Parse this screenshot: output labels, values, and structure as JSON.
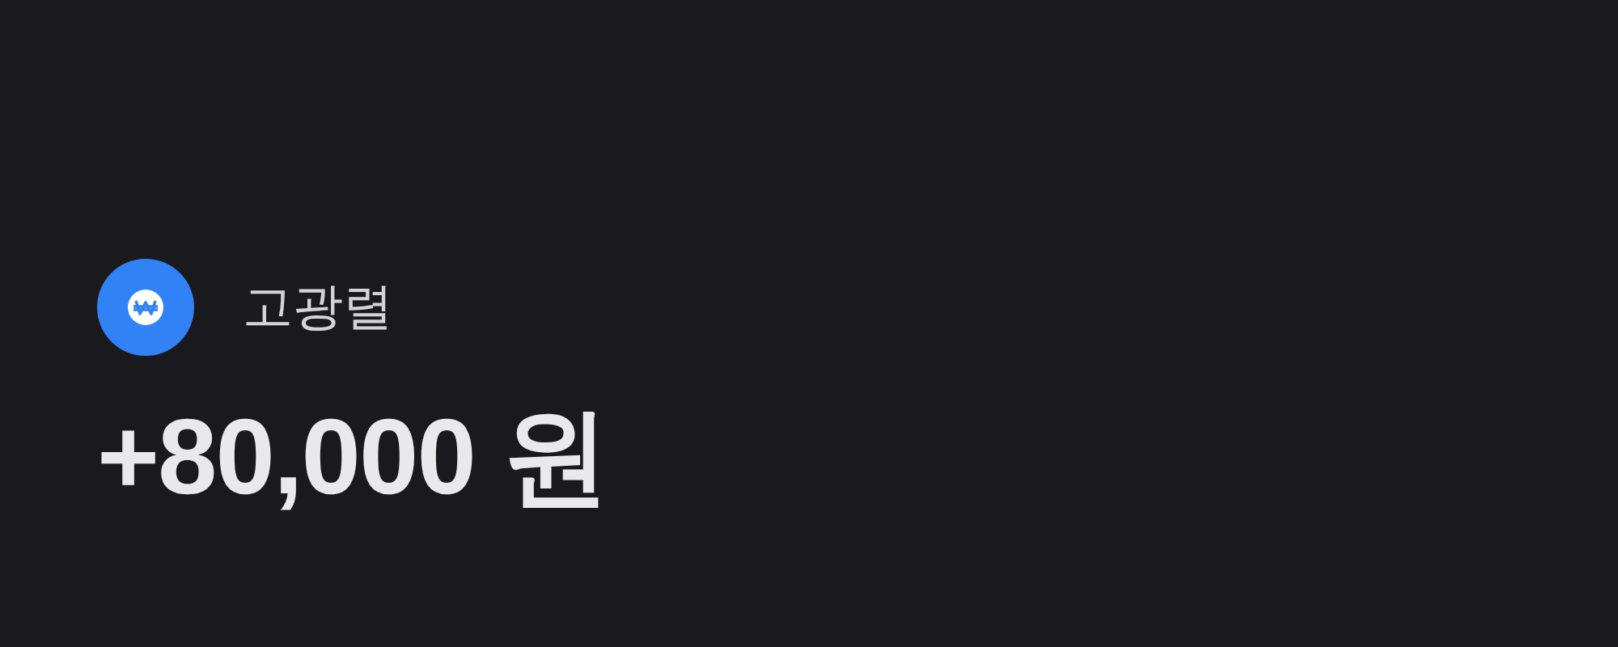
{
  "sender": {
    "name": "고광렬"
  },
  "amount": "+80,000 원"
}
